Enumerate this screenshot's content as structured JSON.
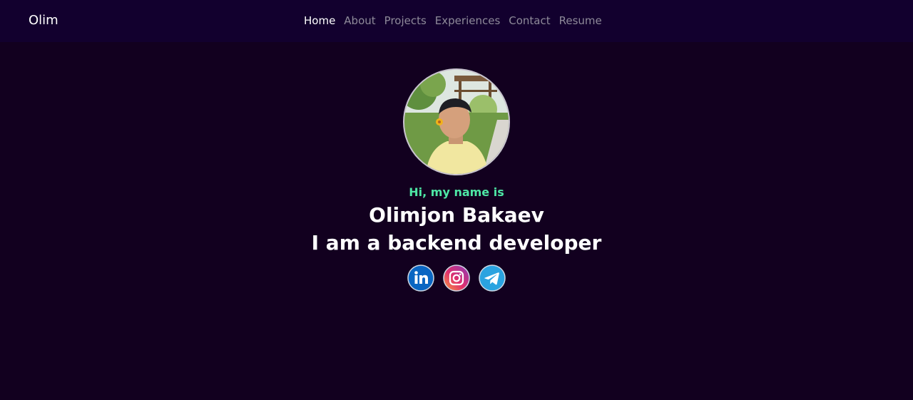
{
  "brand": "Olim",
  "nav": {
    "items": [
      {
        "label": "Home",
        "active": true
      },
      {
        "label": "About",
        "active": false
      },
      {
        "label": "Projects",
        "active": false
      },
      {
        "label": "Experiences",
        "active": false
      },
      {
        "label": "Contact",
        "active": false
      },
      {
        "label": "Resume",
        "active": false
      }
    ]
  },
  "hero": {
    "greeting": "Hi, my name is",
    "name": "Olimjon Bakaev",
    "role": "I am a backend developer"
  },
  "socials": [
    {
      "icon": "linkedin-icon",
      "color": "#0a66c2"
    },
    {
      "icon": "instagram-icon",
      "color": "#d6336c"
    },
    {
      "icon": "telegram-icon",
      "color": "#2aa3e0"
    }
  ],
  "colors": {
    "background": "#12001f",
    "navbar": "#12002e",
    "accent": "#4ee8a6",
    "nav_inactive": "#8e8a99"
  }
}
